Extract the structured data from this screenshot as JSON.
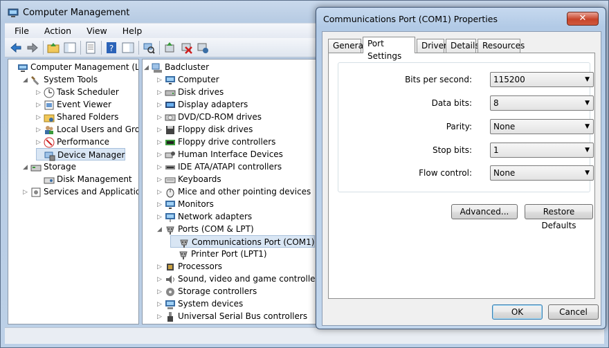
{
  "main_window": {
    "title": "Computer Management",
    "menu": [
      "File",
      "Action",
      "View",
      "Help"
    ]
  },
  "left_tree": [
    {
      "label": "Computer Management (Local",
      "icon": "computer-management-icon",
      "level": 0,
      "expander": ""
    },
    {
      "label": "System Tools",
      "icon": "system-tools-icon",
      "level": 1,
      "expander": "◢"
    },
    {
      "label": "Task Scheduler",
      "icon": "clock-icon",
      "level": 2,
      "expander": "▷"
    },
    {
      "label": "Event Viewer",
      "icon": "event-viewer-icon",
      "level": 2,
      "expander": "▷"
    },
    {
      "label": "Shared Folders",
      "icon": "shared-folder-icon",
      "level": 2,
      "expander": "▷"
    },
    {
      "label": "Local Users and Groups",
      "icon": "users-icon",
      "level": 2,
      "expander": "▷"
    },
    {
      "label": "Performance",
      "icon": "performance-icon",
      "level": 2,
      "expander": "▷"
    },
    {
      "label": "Device Manager",
      "icon": "device-manager-icon",
      "level": 2,
      "expander": "",
      "selected": true
    },
    {
      "label": "Storage",
      "icon": "storage-icon",
      "level": 1,
      "expander": "◢"
    },
    {
      "label": "Disk Management",
      "icon": "disk-management-icon",
      "level": 2,
      "expander": ""
    },
    {
      "label": "Services and Applications",
      "icon": "services-icon",
      "level": 1,
      "expander": "▷"
    }
  ],
  "device_tree": [
    {
      "label": "Badcluster",
      "icon": "computer-icon",
      "level": 0,
      "expander": "◢"
    },
    {
      "label": "Computer",
      "icon": "monitor-icon",
      "level": 1,
      "expander": "▷"
    },
    {
      "label": "Disk drives",
      "icon": "disk-drive-icon",
      "level": 1,
      "expander": "▷"
    },
    {
      "label": "Display adapters",
      "icon": "display-adapter-icon",
      "level": 1,
      "expander": "▷"
    },
    {
      "label": "DVD/CD-ROM drives",
      "icon": "dvd-icon",
      "level": 1,
      "expander": "▷"
    },
    {
      "label": "Floppy disk drives",
      "icon": "floppy-icon",
      "level": 1,
      "expander": "▷"
    },
    {
      "label": "Floppy drive controllers",
      "icon": "controller-icon",
      "level": 1,
      "expander": "▷"
    },
    {
      "label": "Human Interface Devices",
      "icon": "hid-icon",
      "level": 1,
      "expander": "▷"
    },
    {
      "label": "IDE ATA/ATAPI controllers",
      "icon": "ide-icon",
      "level": 1,
      "expander": "▷"
    },
    {
      "label": "Keyboards",
      "icon": "keyboard-icon",
      "level": 1,
      "expander": "▷"
    },
    {
      "label": "Mice and other pointing devices",
      "icon": "mouse-icon",
      "level": 1,
      "expander": "▷"
    },
    {
      "label": "Monitors",
      "icon": "monitor-icon",
      "level": 1,
      "expander": "▷"
    },
    {
      "label": "Network adapters",
      "icon": "network-icon",
      "level": 1,
      "expander": "▷"
    },
    {
      "label": "Ports (COM & LPT)",
      "icon": "port-icon",
      "level": 1,
      "expander": "◢"
    },
    {
      "label": "Communications Port (COM1)",
      "icon": "port-icon",
      "level": 2,
      "expander": "",
      "selected": true
    },
    {
      "label": "Printer Port (LPT1)",
      "icon": "port-icon",
      "level": 2,
      "expander": ""
    },
    {
      "label": "Processors",
      "icon": "processor-icon",
      "level": 1,
      "expander": "▷"
    },
    {
      "label": "Sound, video and game controllers",
      "icon": "sound-icon",
      "level": 1,
      "expander": "▷"
    },
    {
      "label": "Storage controllers",
      "icon": "storage-controller-icon",
      "level": 1,
      "expander": "▷"
    },
    {
      "label": "System devices",
      "icon": "system-devices-icon",
      "level": 1,
      "expander": "▷"
    },
    {
      "label": "Universal Serial Bus controllers",
      "icon": "usb-icon",
      "level": 1,
      "expander": "▷"
    }
  ],
  "dialog": {
    "title": "Communications Port (COM1) Properties",
    "close_symbol": "✕",
    "tabs": [
      "General",
      "Port Settings",
      "Driver",
      "Details",
      "Resources"
    ],
    "active_tab": "Port Settings",
    "fields": [
      {
        "label": "Bits per second:",
        "value": "115200"
      },
      {
        "label": "Data bits:",
        "value": "8"
      },
      {
        "label": "Parity:",
        "value": "None"
      },
      {
        "label": "Stop bits:",
        "value": "1"
      },
      {
        "label": "Flow control:",
        "value": "None"
      }
    ],
    "advanced_label": "Advanced...",
    "restore_label": "Restore Defaults",
    "ok_label": "OK",
    "cancel_label": "Cancel"
  },
  "colors": {
    "selection": "#d9e6f4",
    "close_button": "#c7442a",
    "title_gradient": "#c6d9ef"
  }
}
